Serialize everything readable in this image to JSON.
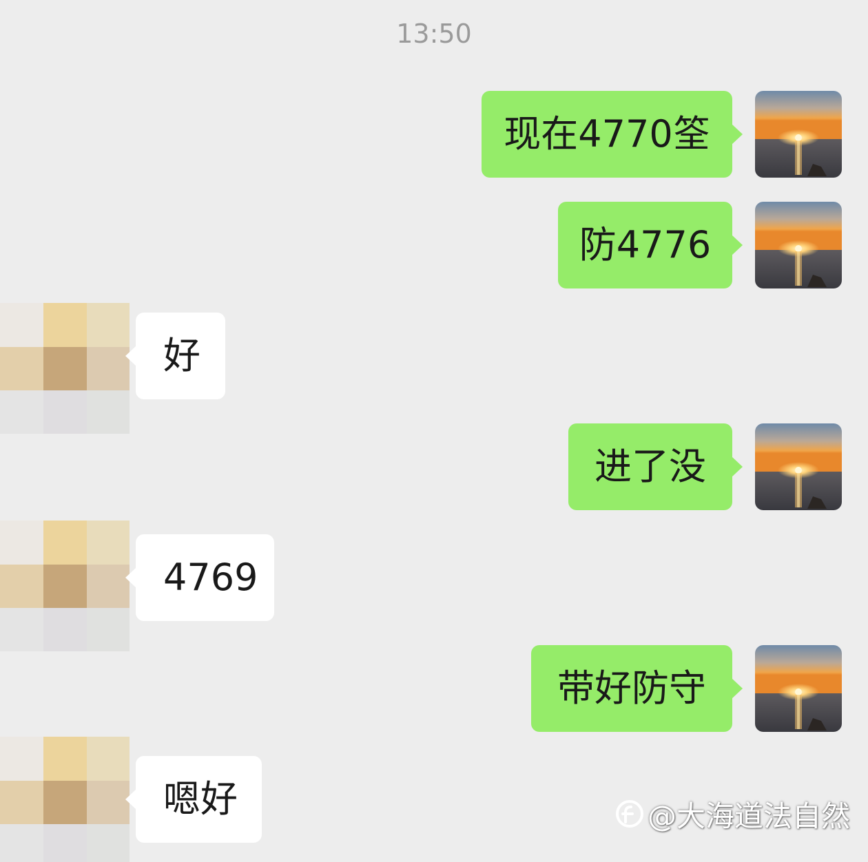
{
  "chat": {
    "timestamp": "13:50",
    "messages": [
      {
        "sender": "self",
        "text": "现在4770筌"
      },
      {
        "sender": "self",
        "text": "防4776"
      },
      {
        "sender": "other",
        "text": "好"
      },
      {
        "sender": "self",
        "text": "进了没"
      },
      {
        "sender": "other",
        "text": "4769"
      },
      {
        "sender": "self",
        "text": "带好防守"
      },
      {
        "sender": "other",
        "text": "嗯好"
      }
    ]
  },
  "watermark": {
    "text": "@大海道法自然"
  },
  "colors": {
    "background": "#ededed",
    "outgoing_bubble": "#95ec69",
    "incoming_bubble": "#ffffff",
    "timestamp_text": "#9a9a9a",
    "message_text": "#191919"
  },
  "icons": {
    "self_avatar": "sunset-avatar-icon",
    "other_avatar": "pixelated-avatar-icon",
    "watermark_logo": "platform-logo-icon"
  }
}
